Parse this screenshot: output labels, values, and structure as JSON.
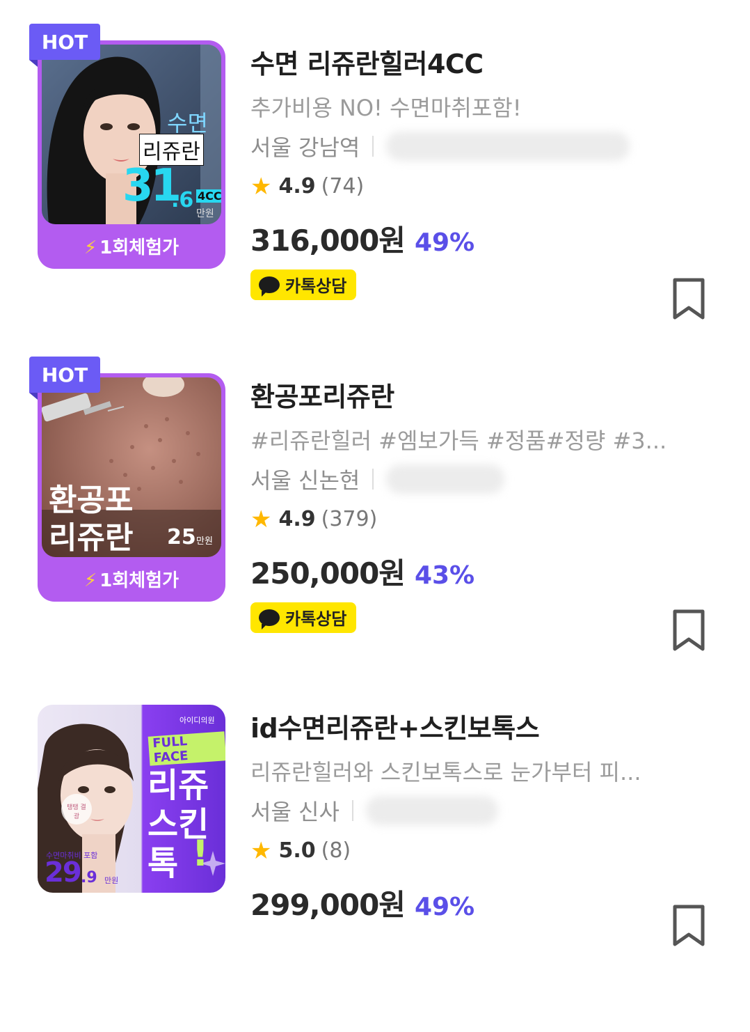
{
  "products": [
    {
      "badge": "HOT",
      "promo": "1회체험가",
      "thumb": {
        "line1": "수면",
        "line2": "리쥬란",
        "price_big": "31",
        "price_dec": ".6",
        "cc": "4CC",
        "unit": "만원"
      },
      "title": "수면 리쥬란힐러4CC",
      "subtitle": "추가비용 NO! 수면마취포함!",
      "location": "서울 강남역",
      "rating": "4.9",
      "reviews": "(74)",
      "price": "316,000원",
      "discount": "49%",
      "kakao_label": "카톡상담"
    },
    {
      "badge": "HOT",
      "promo": "1회체험가",
      "thumb": {
        "line1": "환공포",
        "line2": "리쥬란",
        "price_big": "25",
        "unit": "만원"
      },
      "title": "환공포리쥬란",
      "subtitle": "#리쥬란힐러 #엠보가득 #정품#정량 #3...",
      "location": "서울 신논현",
      "rating": "4.9",
      "reviews": "(379)",
      "price": "250,000원",
      "discount": "43%",
      "kakao_label": "카톡상담"
    },
    {
      "thumb": {
        "brand": "아이디의원",
        "tag": "FULL FACE",
        "line1": "리쥬",
        "line2": "스킨",
        "line3": "톡",
        "excl": "!",
        "note": "수면마취비 포함",
        "price_big": "29",
        "price_dec": ".9",
        "unit": "만원",
        "cheek": "탱탱 결광"
      },
      "title": "id수면리쥬란+스킨보톡스",
      "subtitle": "리쥬란힐러와 스킨보톡스로 눈가부터 피...",
      "location": "서울 신사",
      "rating": "5.0",
      "reviews": "(8)",
      "price": "299,000원",
      "discount": "49%"
    }
  ],
  "colors": {
    "accent": "#5a4fe8",
    "hot_badge": "#6b5bf5",
    "promo_frame": "#b35cf0",
    "kakao": "#ffe600",
    "star": "#ffb800"
  },
  "icons": {
    "star": "star-icon",
    "bookmark": "bookmark-icon",
    "kakao": "kakao-chat-icon",
    "bolt": "lightning-icon"
  }
}
